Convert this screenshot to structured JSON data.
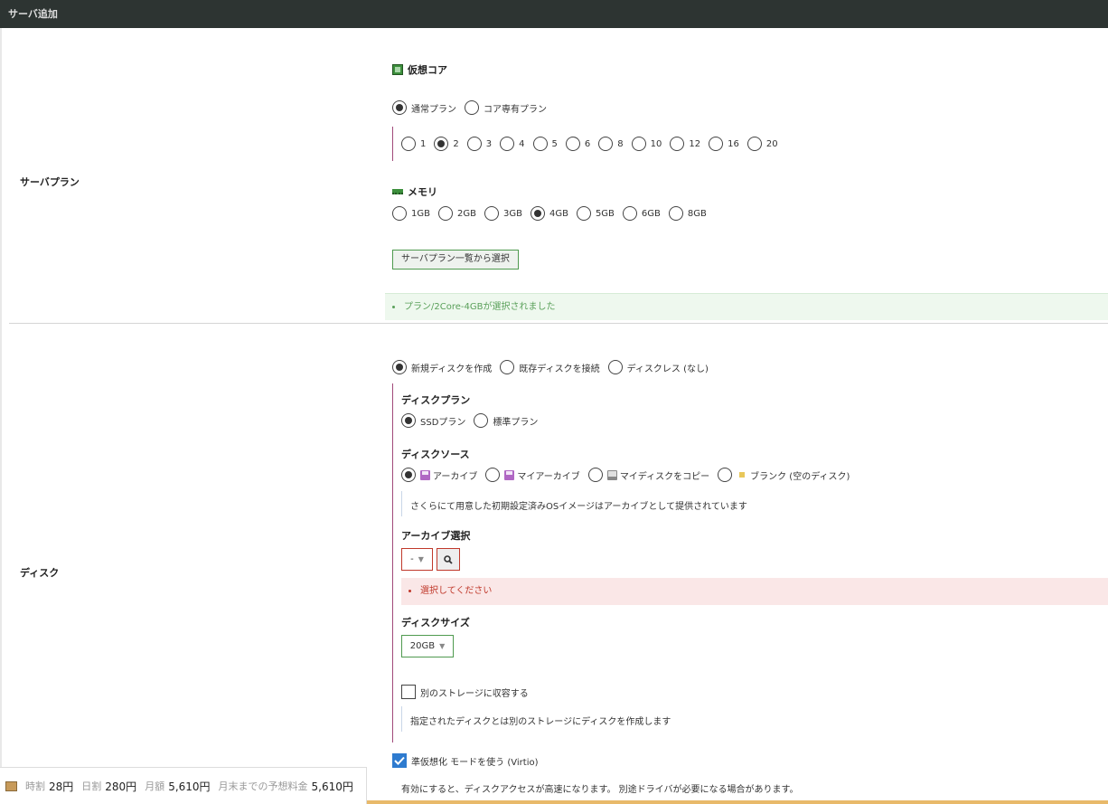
{
  "window": {
    "title": "サーバ追加"
  },
  "server_plan": {
    "row_label": "サーバプラン",
    "cores": {
      "heading": "仮想コア",
      "plan_types": [
        {
          "label": "通常プラン",
          "selected": true
        },
        {
          "label": "コア専有プラン",
          "selected": false
        }
      ],
      "options": [
        {
          "label": "1",
          "selected": false
        },
        {
          "label": "2",
          "selected": true
        },
        {
          "label": "3",
          "selected": false
        },
        {
          "label": "4",
          "selected": false
        },
        {
          "label": "5",
          "selected": false
        },
        {
          "label": "6",
          "selected": false
        },
        {
          "label": "8",
          "selected": false
        },
        {
          "label": "10",
          "selected": false
        },
        {
          "label": "12",
          "selected": false
        },
        {
          "label": "16",
          "selected": false
        },
        {
          "label": "20",
          "selected": false
        }
      ]
    },
    "memory": {
      "heading": "メモリ",
      "options": [
        {
          "label": "1GB",
          "selected": false
        },
        {
          "label": "2GB",
          "selected": false
        },
        {
          "label": "3GB",
          "selected": false
        },
        {
          "label": "4GB",
          "selected": true
        },
        {
          "label": "5GB",
          "selected": false
        },
        {
          "label": "6GB",
          "selected": false
        },
        {
          "label": "8GB",
          "selected": false
        }
      ]
    },
    "select_from_list_button": "サーバプラン一覧から選択",
    "selected_message": "プラン/2Core-4GBが選択されました"
  },
  "disk": {
    "row_label": "ディスク",
    "modes": [
      {
        "label": "新規ディスクを作成",
        "selected": true
      },
      {
        "label": "既存ディスクを接続",
        "selected": false
      },
      {
        "label": "ディスクレス (なし)",
        "selected": false
      }
    ],
    "plan": {
      "heading": "ディスクプラン",
      "options": [
        {
          "label": "SSDプラン",
          "selected": true
        },
        {
          "label": "標準プラン",
          "selected": false
        }
      ]
    },
    "source": {
      "heading": "ディスクソース",
      "options": [
        {
          "label": "アーカイブ",
          "icon": "floppy-icon",
          "selected": true
        },
        {
          "label": "マイアーカイブ",
          "icon": "floppy-icon",
          "selected": false
        },
        {
          "label": "マイディスクをコピー",
          "icon": "disk-icon",
          "selected": false
        },
        {
          "label": "ブランク (空のディスク)",
          "icon": "blank-icon",
          "selected": false
        }
      ],
      "note": "さくらにて用意した初期設定済みOSイメージはアーカイブとして提供されています"
    },
    "archive": {
      "heading": "アーカイブ選択",
      "select_value": "-",
      "error": "選択してください"
    },
    "size": {
      "heading": "ディスクサイズ",
      "value": "20GB"
    },
    "separate_storage": {
      "label": "別のストレージに収容する",
      "checked": false,
      "note": "指定されたディスクとは別のストレージにディスクを作成します"
    },
    "virtio": {
      "label": "準仮想化 モードを使う (Virtio)",
      "checked": true,
      "note": "有効にすると、ディスクアクセスが高速になります。 別途ドライバが必要になる場合があります。"
    }
  },
  "price": {
    "hourly_label": "時割",
    "hourly": "28円",
    "daily_label": "日割",
    "daily": "280円",
    "monthly_label": "月額",
    "monthly": "5,610円",
    "estimate_label": "月末までの予想料金",
    "estimate": "5,610円"
  },
  "colors": {
    "titlebar": "#2d3432",
    "accent_green": "#4f9a4f",
    "error_red": "#c0392b",
    "section_bar": "#a14a7a",
    "checkbox_blue": "#2e7bcf"
  }
}
